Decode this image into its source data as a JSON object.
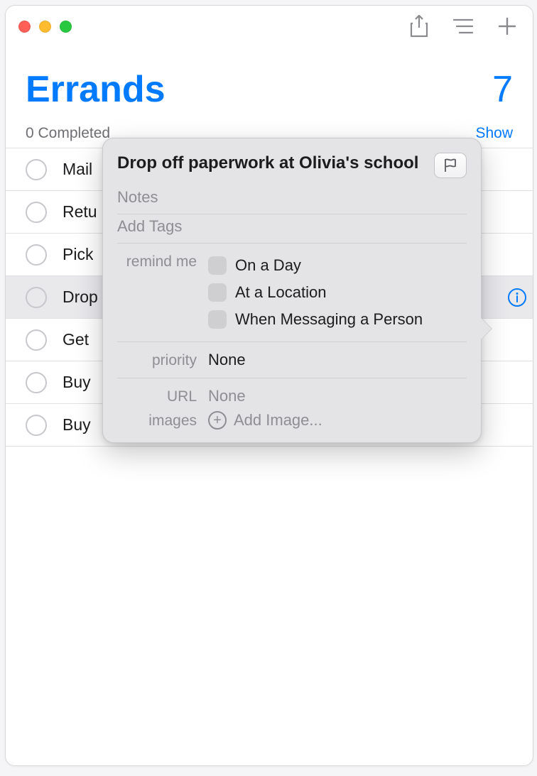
{
  "header": {
    "title": "Errands",
    "count": "7"
  },
  "subheader": {
    "completed": "0 Completed",
    "show": "Show"
  },
  "items": [
    {
      "label": "Mail"
    },
    {
      "label": "Retu"
    },
    {
      "label": "Pick"
    },
    {
      "label": "Drop"
    },
    {
      "label": "Get"
    },
    {
      "label": "Buy"
    },
    {
      "label": "Buy"
    }
  ],
  "popover": {
    "title": "Drop off paperwork at Olivia's school",
    "notes_placeholder": "Notes",
    "tags_placeholder": "Add Tags",
    "remind_label": "remind me",
    "remind_options": {
      "day": "On a Day",
      "location": "At a Location",
      "messaging": "When Messaging a Person"
    },
    "priority_label": "priority",
    "priority_value": "None",
    "url_label": "URL",
    "url_value": "None",
    "images_label": "images",
    "add_image": "Add Image..."
  }
}
